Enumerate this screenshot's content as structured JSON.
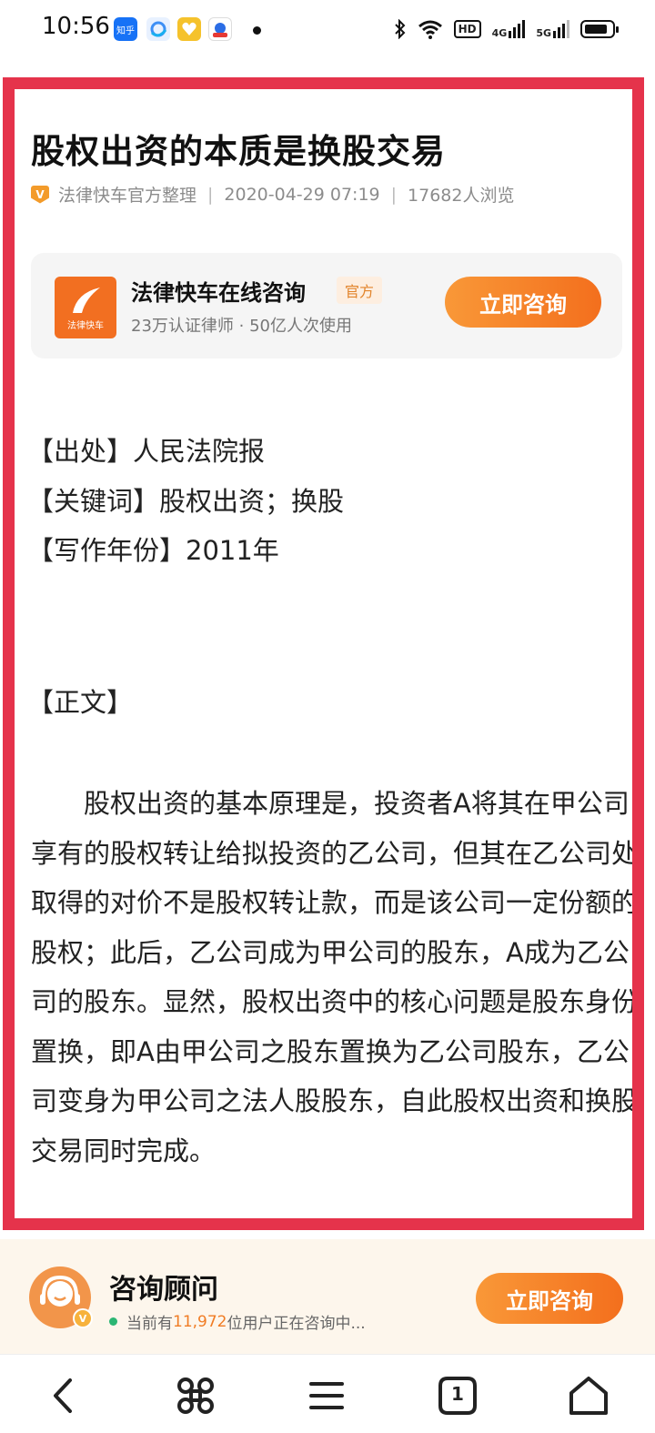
{
  "status_bar": {
    "time": "10:56",
    "apps": [
      {
        "label": "知乎",
        "color": "#1772f6"
      },
      {
        "label": "",
        "color": "#3d8ff5"
      },
      {
        "label": "",
        "color": "#f5c22c"
      },
      {
        "label": "",
        "color": "#ffffff"
      }
    ],
    "hd": "HD",
    "net1": "4G",
    "net2": "5G"
  },
  "article": {
    "title": "股权出资的本质是换股交易",
    "source": "法律快车官方整理",
    "date": "2020-04-29 07:19",
    "views": "17682人浏览",
    "meta_badge": "V"
  },
  "promo_card": {
    "name": "法律快车在线咨询",
    "badge": "官方",
    "subtitle": "23万认证律师 · 50亿人次使用",
    "button": "立即咨询",
    "logo_text": "法律快车"
  },
  "info": {
    "source_line": "【出处】人民法院报",
    "keywords_line": "【关键词】股权出资；换股",
    "year_line": "【写作年份】2011年",
    "body_heading": "【正文】"
  },
  "body": {
    "paragraph": "股权出资的基本原理是，投资者A将其在甲公司享有的股权转让给拟投资的乙公司，但其在乙公司处取得的对价不是股权转让款，而是该公司一定份额的股权；此后，乙公司成为甲公司的股东，A成为乙公司的股东。显然，股权出资中的核心问题是股东身份置换，即A由甲公司之股东置换为乙公司股东，乙公司变身为甲公司之法人股股东，自此股权出资和换股交易同时完成。"
  },
  "consult_bar": {
    "title": "咨询顾问",
    "prefix": "当前有",
    "count": "11,972",
    "suffix": "位用户正在咨询中...",
    "button": "立即咨询",
    "avatar_badge": "V"
  },
  "nav": {
    "tab_count": "1"
  },
  "colors": {
    "frame": "#e5334b",
    "accent": "#f36f1d",
    "online": "#2bb673"
  }
}
